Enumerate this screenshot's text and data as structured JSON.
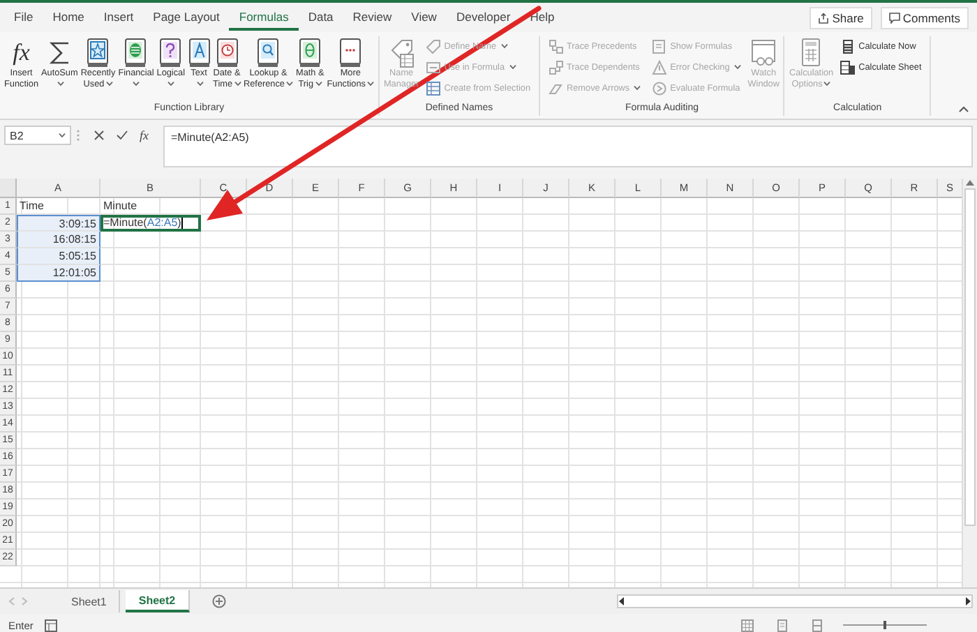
{
  "tabs": [
    {
      "label": "File",
      "selected": false
    },
    {
      "label": "Home",
      "selected": false
    },
    {
      "label": "Insert",
      "selected": false
    },
    {
      "label": "Page Layout",
      "selected": false
    },
    {
      "label": "Formulas",
      "selected": true
    },
    {
      "label": "Data",
      "selected": false
    },
    {
      "label": "Review",
      "selected": false
    },
    {
      "label": "View",
      "selected": false
    },
    {
      "label": "Developer",
      "selected": false
    },
    {
      "label": "Help",
      "selected": false
    }
  ],
  "share_button": "Share",
  "comments_button": "Comments",
  "ribbon_groups": [
    {
      "label": "Function Library",
      "items": [
        {
          "kind": "large",
          "glyph": "fx",
          "lines": [
            "Insert",
            "Function"
          ],
          "dropdown": false,
          "disabled": false
        },
        {
          "kind": "large",
          "lines": [
            "AutoSum"
          ],
          "dropdown": true,
          "disabled": false
        },
        {
          "kind": "large",
          "lines": [
            "Recently",
            "Used"
          ],
          "dropdown": true,
          "disabled": false
        },
        {
          "kind": "large",
          "lines": [
            "Financial"
          ],
          "dropdown": true,
          "disabled": false
        },
        {
          "kind": "large",
          "lines": [
            "Logical"
          ],
          "dropdown": true,
          "disabled": false
        },
        {
          "kind": "large",
          "lines": [
            "Text"
          ],
          "dropdown": true,
          "disabled": false
        },
        {
          "kind": "large",
          "lines": [
            "Date &",
            "Time"
          ],
          "dropdown": true,
          "disabled": false
        },
        {
          "kind": "large",
          "lines": [
            "Lookup &",
            "Reference"
          ],
          "dropdown": true,
          "disabled": false
        },
        {
          "kind": "large",
          "lines": [
            "Math &",
            "Trig"
          ],
          "dropdown": true,
          "disabled": false
        },
        {
          "kind": "large",
          "lines": [
            "More",
            "Functions"
          ],
          "dropdown": true,
          "disabled": false
        }
      ]
    },
    {
      "label": "Defined Names",
      "items": [
        {
          "kind": "large",
          "lines": [
            "Name",
            "Manager"
          ],
          "dropdown": false,
          "disabled": true
        },
        {
          "kind": "stack",
          "items": [
            {
              "label": "Define Name",
              "dropdown": true,
              "disabled": true
            },
            {
              "label": "Use in Formula",
              "dropdown": true,
              "disabled": true
            },
            {
              "label": "Create from Selection",
              "dropdown": false,
              "disabled": true
            }
          ]
        }
      ]
    },
    {
      "label": "Formula Auditing",
      "items": [
        {
          "kind": "stack",
          "items": [
            {
              "label": "Trace Precedents",
              "dropdown": false,
              "disabled": true
            },
            {
              "label": "Trace Dependents",
              "dropdown": false,
              "disabled": true
            },
            {
              "label": "Remove Arrows",
              "dropdown": true,
              "disabled": true
            }
          ]
        },
        {
          "kind": "stack",
          "items": [
            {
              "label": "Show Formulas",
              "dropdown": false,
              "disabled": true
            },
            {
              "label": "Error Checking",
              "dropdown": true,
              "disabled": true
            },
            {
              "label": "Evaluate Formula",
              "dropdown": false,
              "disabled": true
            }
          ]
        },
        {
          "kind": "large",
          "lines": [
            "Watch",
            "Window"
          ],
          "dropdown": false,
          "disabled": true
        }
      ]
    },
    {
      "label": "Calculation",
      "items": [
        {
          "kind": "large",
          "lines": [
            "Calculation",
            "Options"
          ],
          "dropdown": true,
          "disabled": true
        },
        {
          "kind": "stack",
          "items": [
            {
              "label": "Calculate Now",
              "dropdown": false,
              "disabled": false
            },
            {
              "label": "Calculate Sheet",
              "dropdown": false,
              "disabled": false
            }
          ]
        }
      ]
    }
  ],
  "formula_bar": {
    "name_box": "B2",
    "fx_glyph": "fx",
    "formula": "=Minute(A2:A5)"
  },
  "columns": [
    "A",
    "B",
    "C",
    "D",
    "E",
    "F",
    "G",
    "H",
    "I",
    "J",
    "K",
    "L",
    "M",
    "N",
    "O",
    "P",
    "Q",
    "R",
    "S"
  ],
  "rows": [
    {
      "header": "1",
      "cells": [
        {
          "kind": "text",
          "value": "Time",
          "selected": false,
          "referenced": false
        },
        {
          "kind": "text",
          "value": "Minute",
          "selected": false,
          "referenced": false
        }
      ]
    },
    {
      "header": "2",
      "cells": [
        {
          "kind": "time",
          "value": "3:09:15",
          "selected": false,
          "referenced": true
        },
        {
          "kind": "formula",
          "parts": [
            {
              "kind": "plain",
              "text": "=Minute("
            },
            {
              "kind": "reference",
              "text": "A2:A5"
            },
            {
              "kind": "plain",
              "text": ")"
            }
          ],
          "selected": true,
          "referenced": false
        }
      ]
    },
    {
      "header": "3",
      "cells": [
        {
          "kind": "time",
          "value": "16:08:15",
          "selected": false,
          "referenced": true
        }
      ]
    },
    {
      "header": "4",
      "cells": [
        {
          "kind": "time",
          "value": "5:05:15",
          "selected": false,
          "referenced": true
        }
      ]
    },
    {
      "header": "5",
      "cells": [
        {
          "kind": "time",
          "value": "12:01:05",
          "selected": false,
          "referenced": true
        }
      ]
    },
    {
      "header": "6"
    },
    {
      "header": "7"
    },
    {
      "header": "8"
    },
    {
      "header": "9"
    },
    {
      "header": "10"
    },
    {
      "header": "11"
    },
    {
      "header": "12"
    },
    {
      "header": "13"
    },
    {
      "header": "14"
    },
    {
      "header": "15"
    },
    {
      "header": "16"
    },
    {
      "header": "17"
    },
    {
      "header": "18"
    },
    {
      "header": "19"
    },
    {
      "header": "20"
    },
    {
      "header": "21"
    },
    {
      "header": "22"
    }
  ],
  "sheet_tabs": [
    {
      "label": "Sheet1",
      "selected": false
    },
    {
      "label": "Sheet2",
      "selected": true
    }
  ],
  "status_bar": {
    "mode": "Enter",
    "zoom_slider": {
      "level": 0.5
    }
  }
}
